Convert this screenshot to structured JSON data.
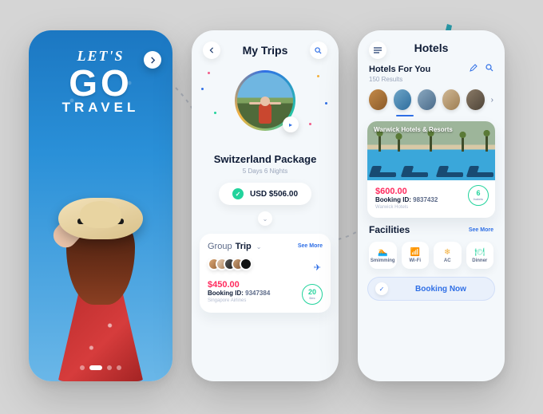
{
  "screen1": {
    "title_line1": "LET'S",
    "title_line2": "GO",
    "title_line3": "TRAVEL"
  },
  "screen2": {
    "title": "My Trips",
    "package_name": "Switzerland Package",
    "package_sub": "5 Days 6 Nights",
    "price": "USD $506.00",
    "group_label": "Group",
    "group_bold": "Trip",
    "see_more": "See More",
    "card_price": "$450.00",
    "booking_label": "Booking ID:",
    "booking_value": "9347384",
    "airline": "Singapore Airlines",
    "day_count": "20",
    "day_label": "Dec"
  },
  "screen3": {
    "title": "Hotels",
    "subtitle": "Hotels For You",
    "results": "150 Results",
    "hotel_overlay": "Warwick Hotels & Resorts",
    "hotel_price": "$600.00",
    "booking_label": "Booking ID:",
    "booking_value": "9837432",
    "hotel_name": "Warwick Hotels",
    "day_count": "6",
    "day_label": "hotels",
    "facilities_title": "Facilities",
    "see_more": "See More",
    "facilities": [
      {
        "icon": "🏊",
        "label": "Smimming",
        "cls": "c1"
      },
      {
        "icon": "📶",
        "label": "Wi-Fi",
        "cls": "c2"
      },
      {
        "icon": "❄",
        "label": "AC",
        "cls": "c3"
      },
      {
        "icon": "🍽",
        "label": "Dinner",
        "cls": "c4"
      }
    ],
    "cta": "Booking Now"
  },
  "colors": {
    "price_red": "#ff2b5e",
    "price_pink": "#ff2b5e",
    "accent_blue": "#2f6fe6",
    "accent_teal": "#22d39c"
  }
}
